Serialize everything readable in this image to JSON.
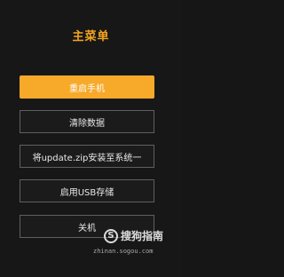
{
  "menu": {
    "title": "主菜单",
    "items": [
      {
        "label": "重启手机"
      },
      {
        "label": "清除数据"
      },
      {
        "label": "将update.zip安装至系统一"
      },
      {
        "label": "启用USB存储"
      },
      {
        "label": "关机"
      }
    ]
  },
  "watermark": {
    "mark": "S",
    "text": "搜狗指南",
    "url": "zhinan.sogou.com"
  },
  "colors": {
    "background": "#171717",
    "accent": "#f7a92a",
    "title": "#f3a421",
    "button_border": "#5f5f5f"
  }
}
